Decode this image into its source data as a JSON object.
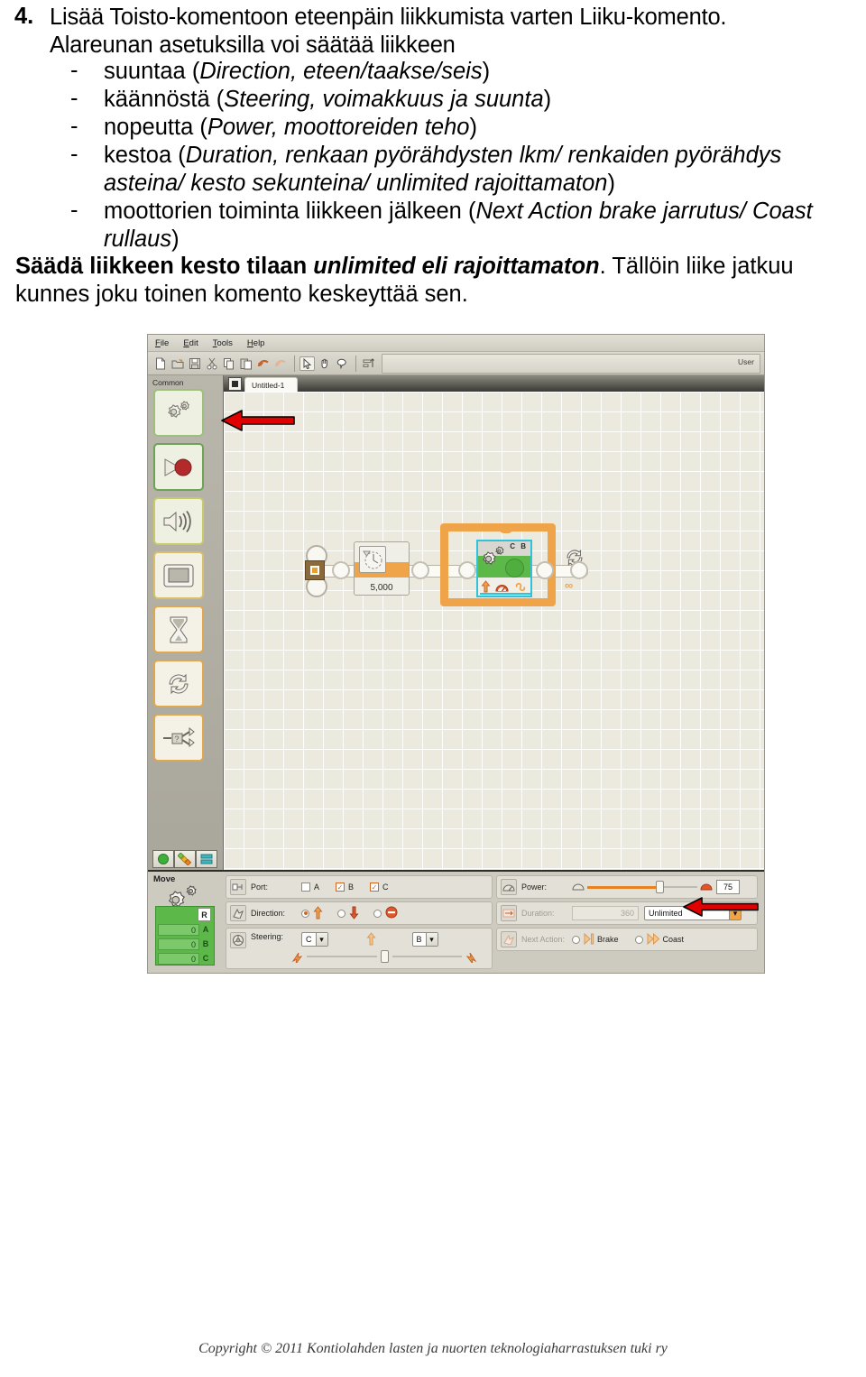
{
  "document": {
    "number": "4.",
    "line1": "Lisää Toisto-komentoon eteenpäin liikkumista varten Liiku-komento.",
    "line2": "Alareunan asetuksilla voi säätää liikkeen",
    "bullets": [
      {
        "dash": "-",
        "plain1": "suuntaa (",
        "italic": "Direction, eteen/taakse/seis",
        "plain2": ")"
      },
      {
        "dash": "-",
        "plain1": "käännöstä (",
        "italic": "Steering, voimakkuus ja suunta",
        "plain2": ")"
      },
      {
        "dash": "-",
        "plain1": "nopeutta  (",
        "italic": "Power, moottoreiden teho",
        "plain2": ")"
      },
      {
        "dash": "-",
        "plain1": "kestoa (",
        "italic": "Duration, renkaan pyörähdysten lkm/ renkaiden pyörähdys",
        "plain2": "",
        "cont_italic": "asteina/ kesto sekunteina/ unlimited rajoittamaton",
        "cont_plain": ")"
      },
      {
        "dash": "-",
        "plain1": "moottorien toiminta liikkeen jälkeen (",
        "italic": "Next Action brake jarrutus/ Coast",
        "plain2": "",
        "cont_italic": "rullaus",
        "cont_plain": ")"
      }
    ],
    "closing_bold": "Säädä liikkeen kesto tilaan ",
    "closing_bolditalic": "unlimited eli rajoittamaton",
    "closing_plain": ". Tällöin liike jatkuu",
    "closing_line2": "kunnes joku toinen komento keskeyttää sen."
  },
  "footer": {
    "copyright": "Copyright © 2011 Kontiolahden lasten ja nuorten teknologiaharrastuksen tuki ry"
  },
  "app": {
    "menu": [
      "File",
      "Edit",
      "Tools",
      "Help"
    ],
    "toolbar_icons": [
      "new-document-icon",
      "open-folder-icon",
      "save-icon",
      "cut-icon",
      "copy-icon",
      "paste-icon",
      "undo-icon",
      "redo-icon",
      "pointer-tool-icon",
      "pan-tool-icon",
      "comment-tool-icon",
      "align-icon"
    ],
    "user_label": "User",
    "palette": {
      "title": "Common",
      "items": [
        {
          "name": "move-block-icon",
          "label": "Move"
        },
        {
          "name": "record-play-block-icon",
          "label": "Record/Play"
        },
        {
          "name": "sound-block-icon",
          "label": "Sound"
        },
        {
          "name": "display-block-icon",
          "label": "Display"
        },
        {
          "name": "wait-block-icon",
          "label": "Wait"
        },
        {
          "name": "loop-block-icon",
          "label": "Loop"
        },
        {
          "name": "switch-block-icon",
          "label": "Switch"
        }
      ],
      "tabs": [
        "common-palette-tab",
        "complete-palette-tab",
        "custom-palette-tab"
      ]
    },
    "document_tab": "Untitled-1",
    "program": {
      "start_block": "start-block",
      "wait_block_value": "5,000",
      "loop_block": "loop-block",
      "move_block_ports": "C B",
      "loop_end_symbol": "∞"
    },
    "config": {
      "title": "Move",
      "port_badge": "R",
      "motor_rows": [
        {
          "value": "0",
          "port": "A"
        },
        {
          "value": "0",
          "port": "B"
        },
        {
          "value": "0",
          "port": "C"
        }
      ],
      "port": {
        "label": "Port:",
        "options": [
          {
            "label": "A",
            "checked": false
          },
          {
            "label": "B",
            "checked": true
          },
          {
            "label": "C",
            "checked": true
          }
        ]
      },
      "direction": {
        "label": "Direction:",
        "options": [
          {
            "icon": "arrow-up-icon",
            "selected": true
          },
          {
            "icon": "arrow-down-icon",
            "selected": false
          },
          {
            "icon": "stop-icon",
            "selected": false
          }
        ]
      },
      "steering": {
        "label": "Steering:",
        "left_motor": "C",
        "right_motor": "B",
        "center_icon": "arrow-up-icon"
      },
      "power": {
        "label": "Power:",
        "value": "75"
      },
      "duration": {
        "label": "Duration:",
        "value": "360",
        "unit": "Unlimited"
      },
      "next_action": {
        "label": "Next Action:",
        "options": [
          {
            "label": "Brake",
            "selected": true
          },
          {
            "label": "Coast",
            "selected": false
          }
        ]
      }
    }
  },
  "annotations": {
    "arrow_palette": "red-arrow-pointing-to-move-palette-item",
    "arrow_duration": "red-arrow-pointing-to-duration-unlimited"
  },
  "colors": {
    "accent_orange": "#f0a44a",
    "block_green": "#5cb848",
    "selection_cyan": "#2fc2d8",
    "annotation_red": "#e00000"
  }
}
